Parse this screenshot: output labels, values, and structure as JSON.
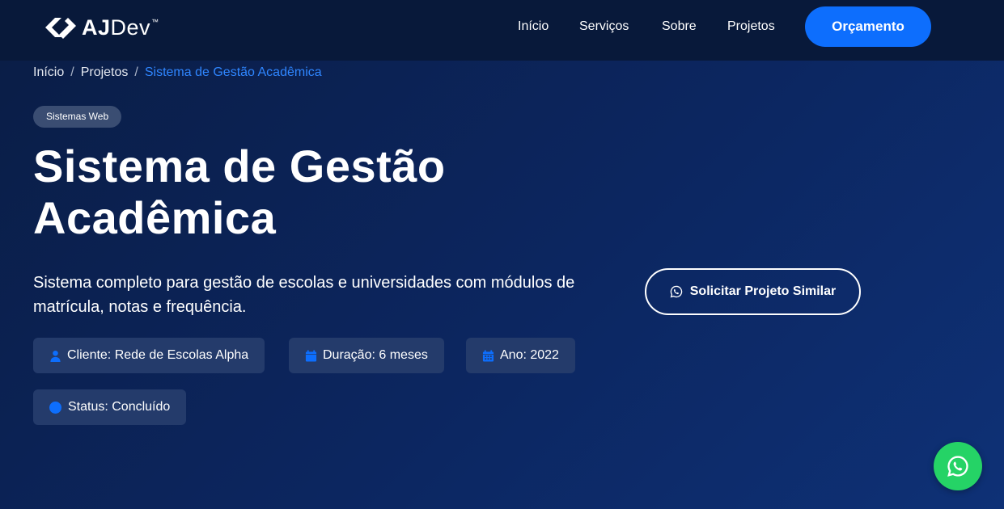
{
  "brand": {
    "name_bold": "AJ",
    "name_light": "Dev",
    "trademark": "™"
  },
  "nav": {
    "links": [
      "Início",
      "Serviços",
      "Sobre",
      "Projetos"
    ],
    "cta_label": "Orçamento"
  },
  "breadcrumb": {
    "items": [
      "Início",
      "Projetos",
      "Sistema de Gestão Acadêmica"
    ],
    "separator": "/"
  },
  "project": {
    "category": "Sistemas Web",
    "title": "Sistema de Gestão Acadêmica",
    "description": "Sistema completo para gestão de escolas e universidades com módulos de matrícula, notas e frequência.",
    "cta_label": "Solicitar Projeto Similar",
    "meta": {
      "client": "Cliente: Rede de Escolas Alpha",
      "duration": "Duração: 6 meses",
      "year": "Ano: 2022",
      "status": "Status: Concluído"
    }
  },
  "colors": {
    "accent": "#0d6efd",
    "nav_bg": "#08193a",
    "chip_bg": "#243b6b",
    "whatsapp": "#25d366"
  },
  "icons": {
    "logo": "ajdev-logo-icon",
    "cta": "whatsapp-icon",
    "client": "user-icon",
    "duration": "calendar-icon",
    "year": "calendar-grid-icon",
    "status": "circle-icon",
    "floating": "whatsapp-icon"
  }
}
